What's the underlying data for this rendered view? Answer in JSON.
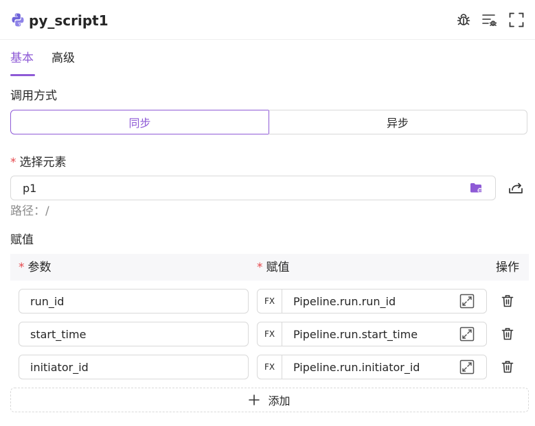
{
  "header": {
    "title": "py_script1",
    "icons": [
      "python-icon",
      "bug-icon",
      "debug-list-icon",
      "fullscreen-icon"
    ]
  },
  "tabs": [
    {
      "label": "基本",
      "active": true
    },
    {
      "label": "高级",
      "active": false
    }
  ],
  "invoke": {
    "label": "调用方式",
    "options": [
      "同步",
      "异步"
    ],
    "selected": "同步"
  },
  "element": {
    "label": "选择元素",
    "value": "p1",
    "path": "路径：/"
  },
  "assign": {
    "section_label": "赋值",
    "columns": [
      "参数",
      "赋值",
      "操作"
    ],
    "fx_label": "FX",
    "rows": [
      {
        "param": "run_id",
        "value": "Pipeline.run.run_id"
      },
      {
        "param": "start_time",
        "value": "Pipeline.run.start_time"
      },
      {
        "param": "initiator_id",
        "value": "Pipeline.run.initiator_id"
      }
    ],
    "add_label": "添加"
  },
  "colors": {
    "accent": "#8e5ad6",
    "required": "#e5484d",
    "border": "#d9d9d9"
  }
}
